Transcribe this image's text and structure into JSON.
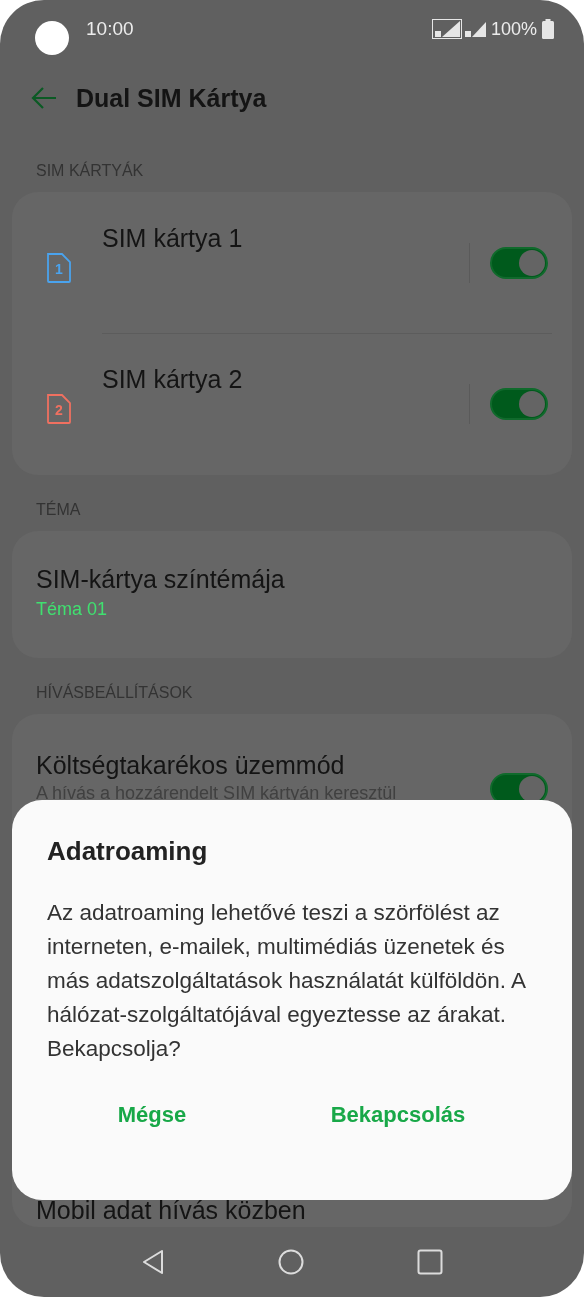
{
  "status_bar": {
    "time": "10:00",
    "battery": "100%"
  },
  "header": {
    "title": "Dual SIM Kártya"
  },
  "sections": [
    {
      "heading": "SIM KÁRTYÁK",
      "items": [
        {
          "kind": "sim",
          "title": "SIM kártya 1",
          "sim_number": "1",
          "color": "#4aa3ee",
          "on": true
        },
        {
          "kind": "sim",
          "title": "SIM kártya 2",
          "sim_number": "2",
          "color": "#f07060",
          "on": true
        }
      ]
    },
    {
      "heading": "TÉMA",
      "items": [
        {
          "kind": "value",
          "title": "SIM-kártya színtémája",
          "value": "Téma 01"
        }
      ]
    },
    {
      "heading": "HÍVÁSBEÁLLÍTÁSOK",
      "items": [
        {
          "kind": "toggle",
          "title": "Költségtakarékos üzemmód",
          "subtitle": "A hívás a hozzárendelt SIM kártyán keresztül",
          "on": true
        },
        {
          "kind": "plain",
          "title": "Mobil adat hívás közben"
        }
      ]
    }
  ],
  "dialog": {
    "title": "Adatroaming",
    "message": "Az adatroaming lehetővé teszi a szörfölést az interneten, e-mailek, multimédiás üzenetek és más adatszolgáltatások használatát külföldön. A hálózat-szolgáltatójával egyeztesse az árakat. Bekapcsolja?",
    "buttons": [
      "Mégse",
      "Bekapcsolás"
    ]
  }
}
